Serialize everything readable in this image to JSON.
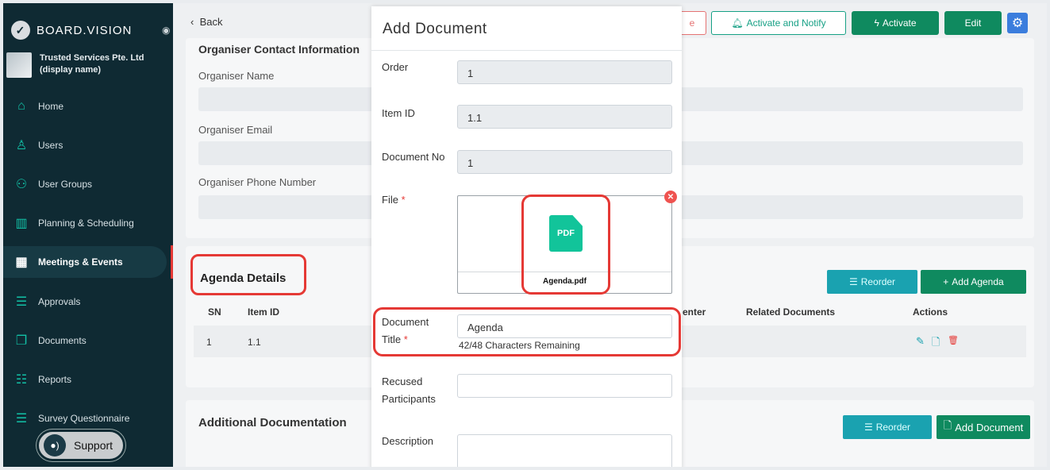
{
  "sidebar": {
    "brand": "BOARD.VISION",
    "org_name": "Trusted Services Pte. Ltd (display name)",
    "items": [
      {
        "label": "Home",
        "icon": "home-icon"
      },
      {
        "label": "Users",
        "icon": "user-icon"
      },
      {
        "label": "User Groups",
        "icon": "users-icon"
      },
      {
        "label": "Planning & Scheduling",
        "icon": "chart-bars-icon"
      },
      {
        "label": "Meetings & Events",
        "icon": "calendar-icon",
        "active": true
      },
      {
        "label": "Approvals",
        "icon": "checklist-icon"
      },
      {
        "label": "Documents",
        "icon": "documents-icon"
      },
      {
        "label": "Reports",
        "icon": "report-icon"
      },
      {
        "label": "Survey Questionnaire",
        "icon": "survey-icon"
      }
    ],
    "support_label": "Support"
  },
  "topbar": {
    "back_label": "Back",
    "partial_button_label": "e",
    "activate_notify_label": "Activate and Notify",
    "activate_label": "Activate",
    "edit_label": "Edit"
  },
  "organiser": {
    "section_title": "Organiser Contact Information",
    "name_label": "Organiser Name",
    "email_label": "Organiser Email",
    "phone_label": "Organiser Phone Number"
  },
  "agenda": {
    "title": "Agenda Details",
    "reorder_label": "Reorder",
    "add_agenda_label": "Add Agenda",
    "columns": {
      "sn": "SN",
      "item_id": "Item ID",
      "presenter_partial": "enter",
      "related_docs": "Related Documents",
      "actions": "Actions"
    },
    "rows": [
      {
        "sn": "1",
        "item_id": "1.1"
      }
    ]
  },
  "additional": {
    "title": "Additional Documentation",
    "reorder_label": "Reorder",
    "add_document_label": "Add Document"
  },
  "modal": {
    "title": "Add Document",
    "order_label": "Order",
    "order_value": "1",
    "item_id_label": "Item ID",
    "item_id_value": "1.1",
    "doc_no_label": "Document No",
    "doc_no_value": "1",
    "file_label": "File",
    "file_name": "Agenda.pdf",
    "file_type": "PDF",
    "doc_title_label_1": "Document",
    "doc_title_label_2": "Title",
    "doc_title_value": "Agenda",
    "counter_text": "42/48 Characters Remaining",
    "recused_label_1": "Recused",
    "recused_label_2": "Participants",
    "description_label": "Description",
    "required_mark": "*"
  },
  "colors": {
    "sidebar_bg": "#0f2a33",
    "accent_green": "#0f8a5f",
    "teal": "#1aa2b0",
    "highlight_red": "#e53935",
    "pdf_green": "#12c49a"
  }
}
